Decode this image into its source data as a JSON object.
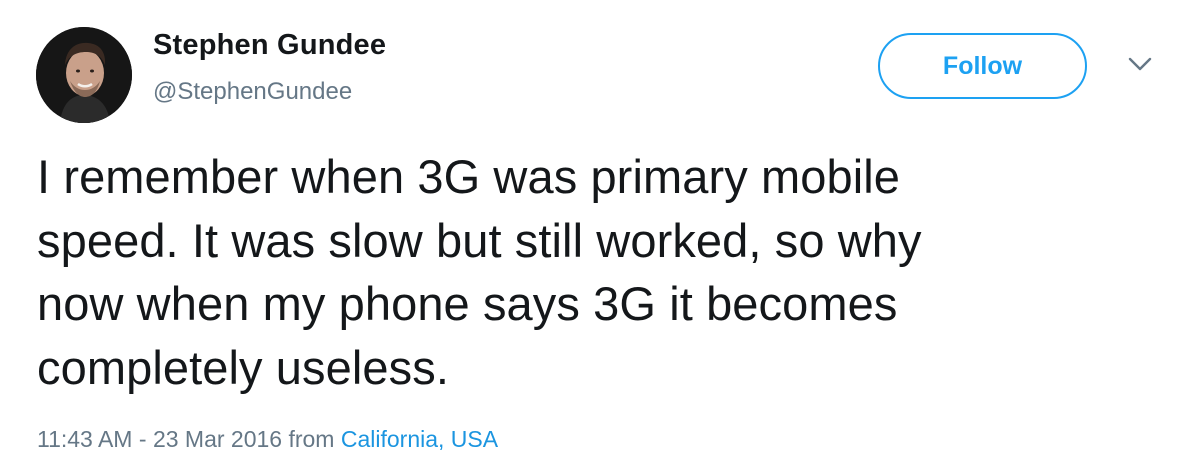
{
  "author": {
    "name": "Stephen Gundee",
    "handle": "@StephenGundee"
  },
  "actions": {
    "follow_label": "Follow"
  },
  "icons": {
    "caret": "chevron-down-icon"
  },
  "tweet": {
    "lines": [
      "I remember when 3G was primary mobile",
      "speed. It was slow but still worked, so why",
      "now when my phone says 3G it becomes",
      "completely useless."
    ],
    "time": "11:43 AM",
    "separator": " - ",
    "date": "23 Mar 2016",
    "from_text": " from ",
    "location": "California, USA"
  },
  "colors": {
    "accent": "#1da1f2",
    "link": "#1b95e0",
    "text": "#14171a",
    "muted": "#657786"
  }
}
